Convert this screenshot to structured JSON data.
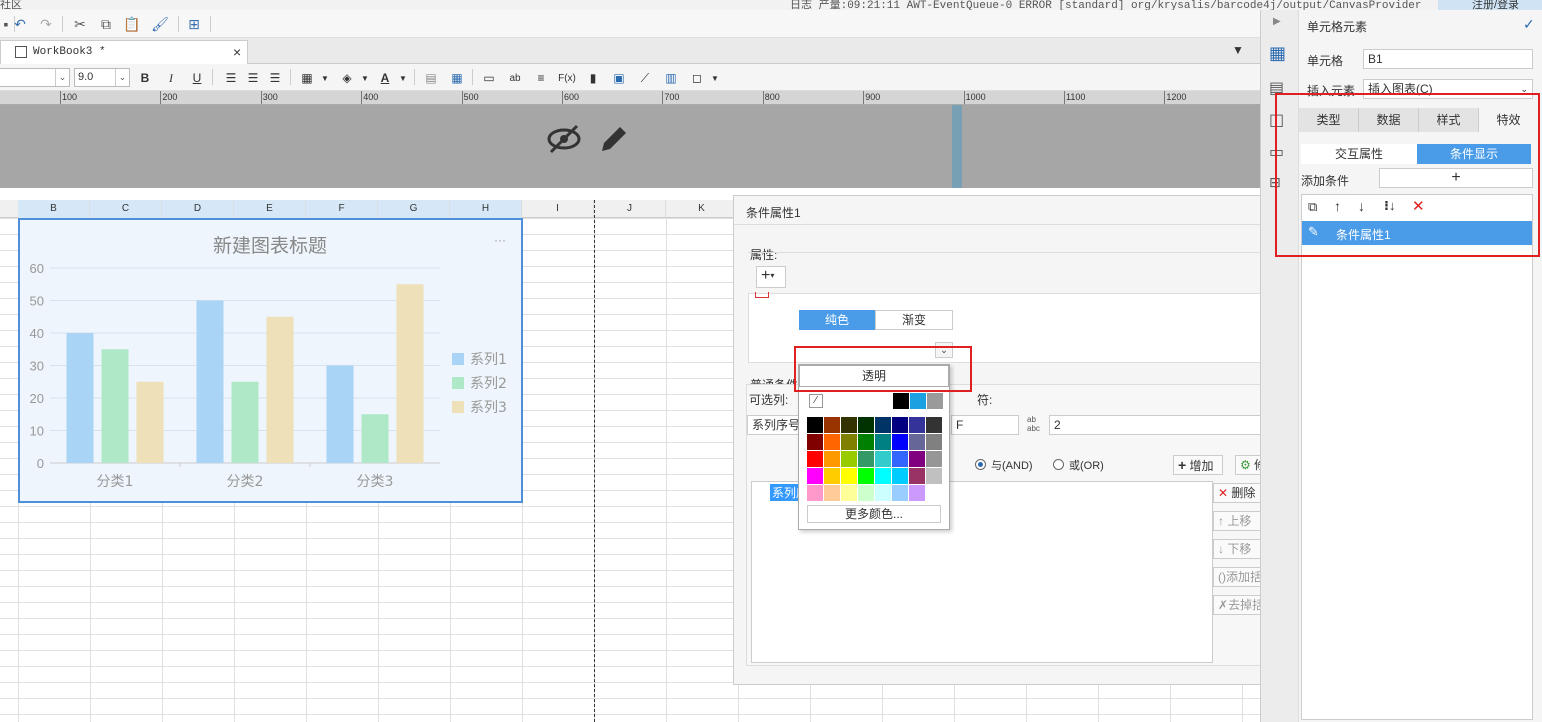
{
  "topstrip": {
    "left_text": "社区",
    "right_text": "日志  产量:09:21:11 AWT-EventQueue-0 ERROR [standard] org/krysalis/barcode4j/output/CanvasProvider",
    "login_label": "注册/登录"
  },
  "quickbar": {
    "icons": [
      "undo-icon",
      "redo-icon",
      "cut-icon",
      "copy-icon",
      "paste-icon",
      "format-brush-icon",
      "preview-icon"
    ]
  },
  "tabs": [
    {
      "label": "WorkBook3 *"
    }
  ],
  "format": {
    "font_size": "9.0",
    "bold": "B",
    "italic": "I",
    "underline": "U"
  },
  "ruler": {
    "ticks": [
      "100",
      "200",
      "300",
      "400",
      "500",
      "600",
      "700",
      "800",
      "900",
      "1000",
      "1100",
      "1200"
    ]
  },
  "sheet": {
    "columns": [
      "B",
      "C",
      "D",
      "E",
      "F",
      "G",
      "H",
      "I",
      "J",
      "K"
    ]
  },
  "chart_data": {
    "type": "bar",
    "title": "新建图表标题",
    "categories": [
      "分类1",
      "分类2",
      "分类3"
    ],
    "series": [
      {
        "name": "系列1",
        "values": [
          40,
          50,
          30
        ],
        "color": "#a9d4f5"
      },
      {
        "name": "系列2",
        "values": [
          35,
          25,
          15
        ],
        "color": "#aee8c6"
      },
      {
        "name": "系列3",
        "values": [
          25,
          45,
          55
        ],
        "color": "#eee0b8"
      }
    ],
    "ylim": [
      0,
      60
    ],
    "yticks": [
      "0",
      "10",
      "20",
      "30",
      "40",
      "50",
      "60"
    ],
    "legend_position": "right",
    "grid": true,
    "menu_glyph": "···"
  },
  "dialog": {
    "title": "条件属性1",
    "attr_label": "属性:",
    "add_glyph": "+",
    "fill_tabs": [
      "纯色",
      "渐变"
    ],
    "normal_condition_label": "普通条件",
    "optional_col_label": "可选列:",
    "operator_label": "符:",
    "col_value": "系列序号",
    "op_value": "F",
    "value_input": "2",
    "and_label": "与(AND)",
    "or_label": "或(OR)",
    "add_btn": "增加",
    "modify_btn": "修改",
    "delete_btn": "删除",
    "moveup_btn": "上移",
    "movedown_btn": "下移",
    "addbracket_btn": "添加括号",
    "removebracket_btn": "去掉括号",
    "list_item": "系列序"
  },
  "colorpop": {
    "transparent_label": "透明",
    "more_colors_label": "更多颜色...",
    "top_row": [
      "#000000",
      "#1ba1e2",
      "#9a9a9a"
    ],
    "palette": [
      [
        "#000000",
        "#993300",
        "#333300",
        "#003300",
        "#003366",
        "#000080",
        "#333399",
        "#333333"
      ],
      [
        "#800000",
        "#ff6600",
        "#808000",
        "#008000",
        "#008080",
        "#0000ff",
        "#666699",
        "#808080"
      ],
      [
        "#ff0000",
        "#ff9900",
        "#99cc00",
        "#339966",
        "#33cccc",
        "#3366ff",
        "#800080",
        "#969696"
      ],
      [
        "#ff00ff",
        "#ffcc00",
        "#ffff00",
        "#00ff00",
        "#00ffff",
        "#00ccff",
        "#993366",
        "#c0c0c0"
      ],
      [
        "#ff99cc",
        "#ffcc99",
        "#ffff99",
        "#ccffcc",
        "#ccffff",
        "#99ccff",
        "#cc99ff",
        "#ffffff"
      ]
    ]
  },
  "rightpanel": {
    "title": "单元格元素",
    "cell_label": "单元格",
    "cell_value": "B1",
    "insert_label": "插入元素",
    "insert_value": "插入图表(C)",
    "tabs": [
      "类型",
      "数据",
      "样式",
      "特效"
    ],
    "sub_tabs": [
      "交互属性",
      "条件显示"
    ],
    "add_condition_label": "添加条件",
    "add_glyph": "+",
    "condition_item": "条件属性1"
  }
}
